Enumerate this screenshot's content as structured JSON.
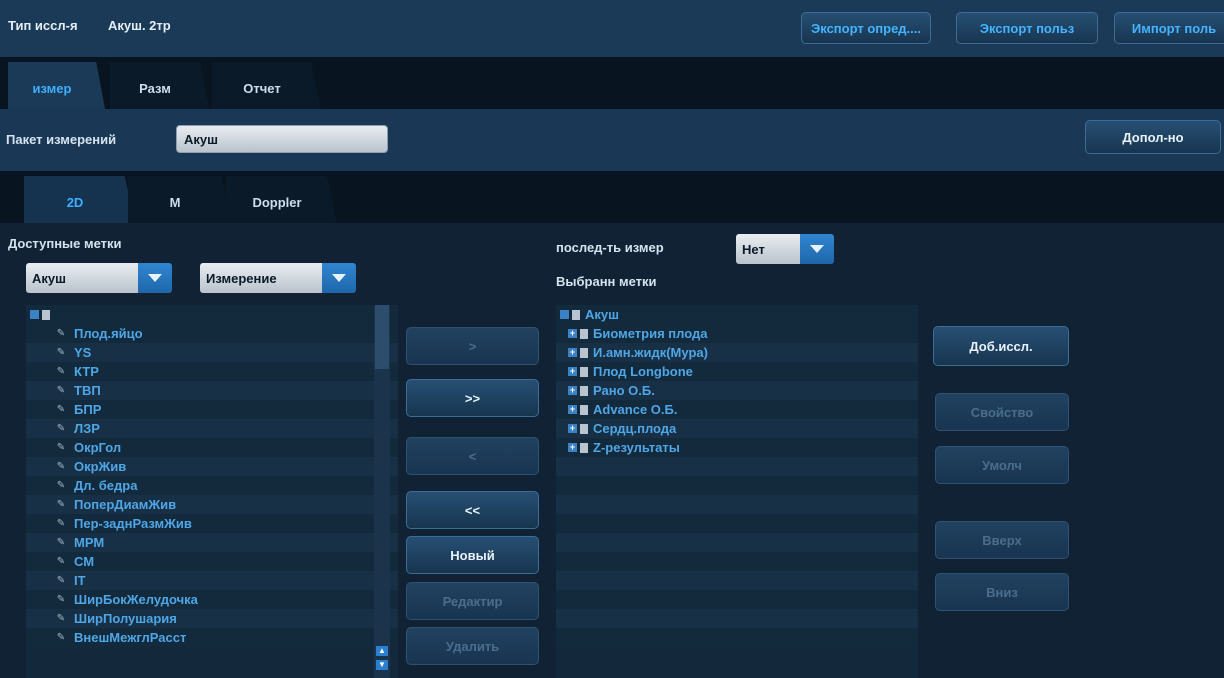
{
  "top": {
    "exam_type_label": "Тип иссл-я",
    "exam_type_value": "Акуш. 2тр",
    "export_def": "Экспорт опред....",
    "export_user": "Экспорт польз",
    "import_user": "Импорт поль"
  },
  "tabs": [
    "измер",
    "Разм",
    "Отчет"
  ],
  "package": {
    "label": "Пакет измерений",
    "value": "Акуш",
    "extra_button": "Допол-но"
  },
  "mode_tabs": [
    "2D",
    "M",
    "Doppler"
  ],
  "available": {
    "title": "Доступные метки",
    "dropdown1": "Акуш",
    "dropdown2": "Измерение",
    "items": [
      "Плод.яйцо",
      "YS",
      "КТР",
      "ТВП",
      "БПР",
      "ЛЗР",
      "ОкрГол",
      "ОкрЖив",
      "Дл. бедра",
      "ПоперДиамЖив",
      "Пер-заднРазмЖив",
      "МРМ",
      "СМ",
      "IT",
      "ШирБокЖелудочка",
      "ШирПолушария",
      "ВнешМежглРасст"
    ]
  },
  "middle_buttons": {
    "add": ">",
    "add_all": ">>",
    "remove": "<",
    "remove_all": "<<",
    "new": "Новый",
    "edit": "Редактир",
    "delete": "Удалить"
  },
  "sequence": {
    "label": "послед-ть измер",
    "value": "Нет"
  },
  "selected": {
    "title": "Выбранн метки",
    "root": "Акуш",
    "items": [
      "Биометрия плода",
      "И.амн.жидк(Мура)",
      "Плод Longbone",
      "Рано О.Б.",
      "Advance О.Б.",
      "Сердц.плода",
      "Z-результаты"
    ]
  },
  "right_buttons": {
    "add_exam": "Доб.иссл.",
    "property": "Свойство",
    "default": "Умолч",
    "up": "Вверх",
    "down": "Вниз"
  },
  "colors": {
    "accent": "#3fb0ff",
    "background": "#102234",
    "topbar": "#1b3a57"
  }
}
